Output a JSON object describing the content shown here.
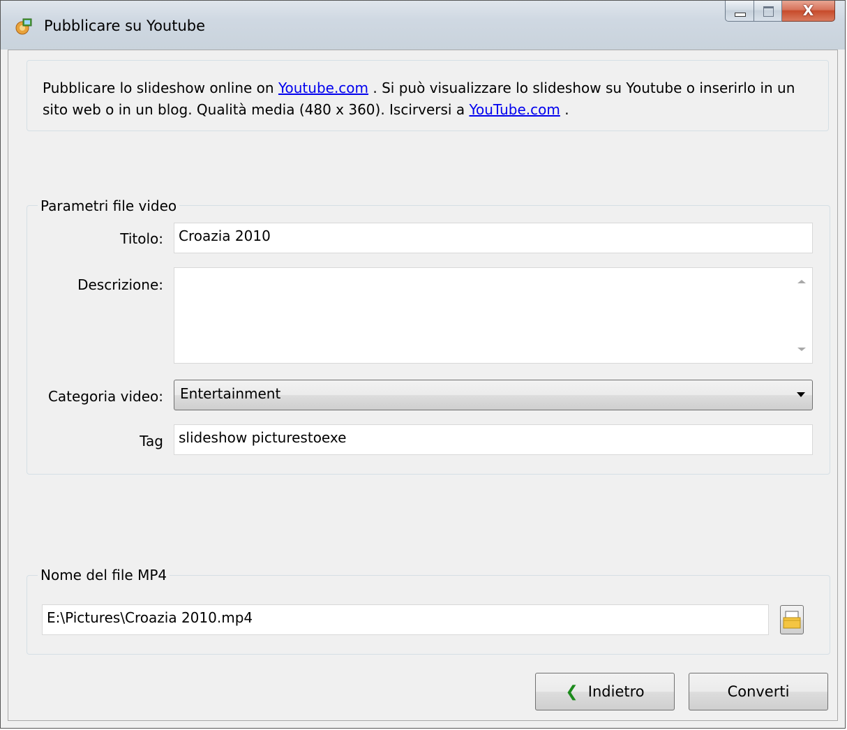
{
  "window": {
    "title": "Pubblicare su Youtube",
    "close_glyph": "X"
  },
  "intro": {
    "text1": "Pubblicare lo slideshow online on ",
    "link1": "Youtube.com",
    "text2": " . Si può visualizzare lo slideshow su Youtube o inserirlo in un sito web o in un blog. Qualità media (480 x 360). Iscirversi a ",
    "link2": "YouTube.com",
    "text3": " ."
  },
  "video_params": {
    "group_title": "Parametri file video",
    "title_label": "Titolo:",
    "title_value": "Croazia 2010",
    "description_label": "Descrizione:",
    "description_value": "",
    "category_label": "Categoria video:",
    "category_value": "Entertainment",
    "tag_label": "Tag",
    "tag_value": "slideshow picturestoexe"
  },
  "mp4": {
    "group_title": "Nome del file MP4",
    "path_value": "E:\\Pictures\\Croazia 2010.mp4"
  },
  "buttons": {
    "back_label": "Indietro",
    "back_glyph": "❮",
    "convert_label": "Converti"
  },
  "icons": {
    "app": "app-icon",
    "folder": "folder-open-icon"
  }
}
